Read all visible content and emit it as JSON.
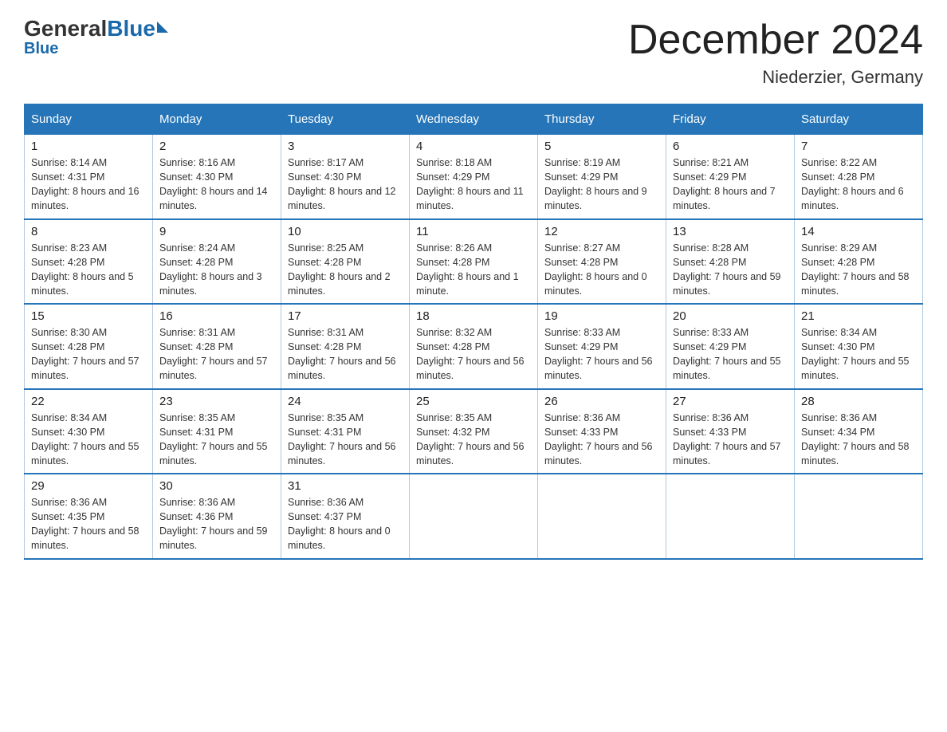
{
  "header": {
    "logo_general": "General",
    "logo_blue": "Blue",
    "title": "December 2024",
    "location": "Niederzier, Germany"
  },
  "weekdays": [
    "Sunday",
    "Monday",
    "Tuesday",
    "Wednesday",
    "Thursday",
    "Friday",
    "Saturday"
  ],
  "weeks": [
    [
      {
        "day": "1",
        "sunrise": "8:14 AM",
        "sunset": "4:31 PM",
        "daylight": "8 hours and 16 minutes."
      },
      {
        "day": "2",
        "sunrise": "8:16 AM",
        "sunset": "4:30 PM",
        "daylight": "8 hours and 14 minutes."
      },
      {
        "day": "3",
        "sunrise": "8:17 AM",
        "sunset": "4:30 PM",
        "daylight": "8 hours and 12 minutes."
      },
      {
        "day": "4",
        "sunrise": "8:18 AM",
        "sunset": "4:29 PM",
        "daylight": "8 hours and 11 minutes."
      },
      {
        "day": "5",
        "sunrise": "8:19 AM",
        "sunset": "4:29 PM",
        "daylight": "8 hours and 9 minutes."
      },
      {
        "day": "6",
        "sunrise": "8:21 AM",
        "sunset": "4:29 PM",
        "daylight": "8 hours and 7 minutes."
      },
      {
        "day": "7",
        "sunrise": "8:22 AM",
        "sunset": "4:28 PM",
        "daylight": "8 hours and 6 minutes."
      }
    ],
    [
      {
        "day": "8",
        "sunrise": "8:23 AM",
        "sunset": "4:28 PM",
        "daylight": "8 hours and 5 minutes."
      },
      {
        "day": "9",
        "sunrise": "8:24 AM",
        "sunset": "4:28 PM",
        "daylight": "8 hours and 3 minutes."
      },
      {
        "day": "10",
        "sunrise": "8:25 AM",
        "sunset": "4:28 PM",
        "daylight": "8 hours and 2 minutes."
      },
      {
        "day": "11",
        "sunrise": "8:26 AM",
        "sunset": "4:28 PM",
        "daylight": "8 hours and 1 minute."
      },
      {
        "day": "12",
        "sunrise": "8:27 AM",
        "sunset": "4:28 PM",
        "daylight": "8 hours and 0 minutes."
      },
      {
        "day": "13",
        "sunrise": "8:28 AM",
        "sunset": "4:28 PM",
        "daylight": "7 hours and 59 minutes."
      },
      {
        "day": "14",
        "sunrise": "8:29 AM",
        "sunset": "4:28 PM",
        "daylight": "7 hours and 58 minutes."
      }
    ],
    [
      {
        "day": "15",
        "sunrise": "8:30 AM",
        "sunset": "4:28 PM",
        "daylight": "7 hours and 57 minutes."
      },
      {
        "day": "16",
        "sunrise": "8:31 AM",
        "sunset": "4:28 PM",
        "daylight": "7 hours and 57 minutes."
      },
      {
        "day": "17",
        "sunrise": "8:31 AM",
        "sunset": "4:28 PM",
        "daylight": "7 hours and 56 minutes."
      },
      {
        "day": "18",
        "sunrise": "8:32 AM",
        "sunset": "4:28 PM",
        "daylight": "7 hours and 56 minutes."
      },
      {
        "day": "19",
        "sunrise": "8:33 AM",
        "sunset": "4:29 PM",
        "daylight": "7 hours and 56 minutes."
      },
      {
        "day": "20",
        "sunrise": "8:33 AM",
        "sunset": "4:29 PM",
        "daylight": "7 hours and 55 minutes."
      },
      {
        "day": "21",
        "sunrise": "8:34 AM",
        "sunset": "4:30 PM",
        "daylight": "7 hours and 55 minutes."
      }
    ],
    [
      {
        "day": "22",
        "sunrise": "8:34 AM",
        "sunset": "4:30 PM",
        "daylight": "7 hours and 55 minutes."
      },
      {
        "day": "23",
        "sunrise": "8:35 AM",
        "sunset": "4:31 PM",
        "daylight": "7 hours and 55 minutes."
      },
      {
        "day": "24",
        "sunrise": "8:35 AM",
        "sunset": "4:31 PM",
        "daylight": "7 hours and 56 minutes."
      },
      {
        "day": "25",
        "sunrise": "8:35 AM",
        "sunset": "4:32 PM",
        "daylight": "7 hours and 56 minutes."
      },
      {
        "day": "26",
        "sunrise": "8:36 AM",
        "sunset": "4:33 PM",
        "daylight": "7 hours and 56 minutes."
      },
      {
        "day": "27",
        "sunrise": "8:36 AM",
        "sunset": "4:33 PM",
        "daylight": "7 hours and 57 minutes."
      },
      {
        "day": "28",
        "sunrise": "8:36 AM",
        "sunset": "4:34 PM",
        "daylight": "7 hours and 58 minutes."
      }
    ],
    [
      {
        "day": "29",
        "sunrise": "8:36 AM",
        "sunset": "4:35 PM",
        "daylight": "7 hours and 58 minutes."
      },
      {
        "day": "30",
        "sunrise": "8:36 AM",
        "sunset": "4:36 PM",
        "daylight": "7 hours and 59 minutes."
      },
      {
        "day": "31",
        "sunrise": "8:36 AM",
        "sunset": "4:37 PM",
        "daylight": "8 hours and 0 minutes."
      },
      null,
      null,
      null,
      null
    ]
  ],
  "labels": {
    "sunrise": "Sunrise:",
    "sunset": "Sunset:",
    "daylight": "Daylight:"
  }
}
